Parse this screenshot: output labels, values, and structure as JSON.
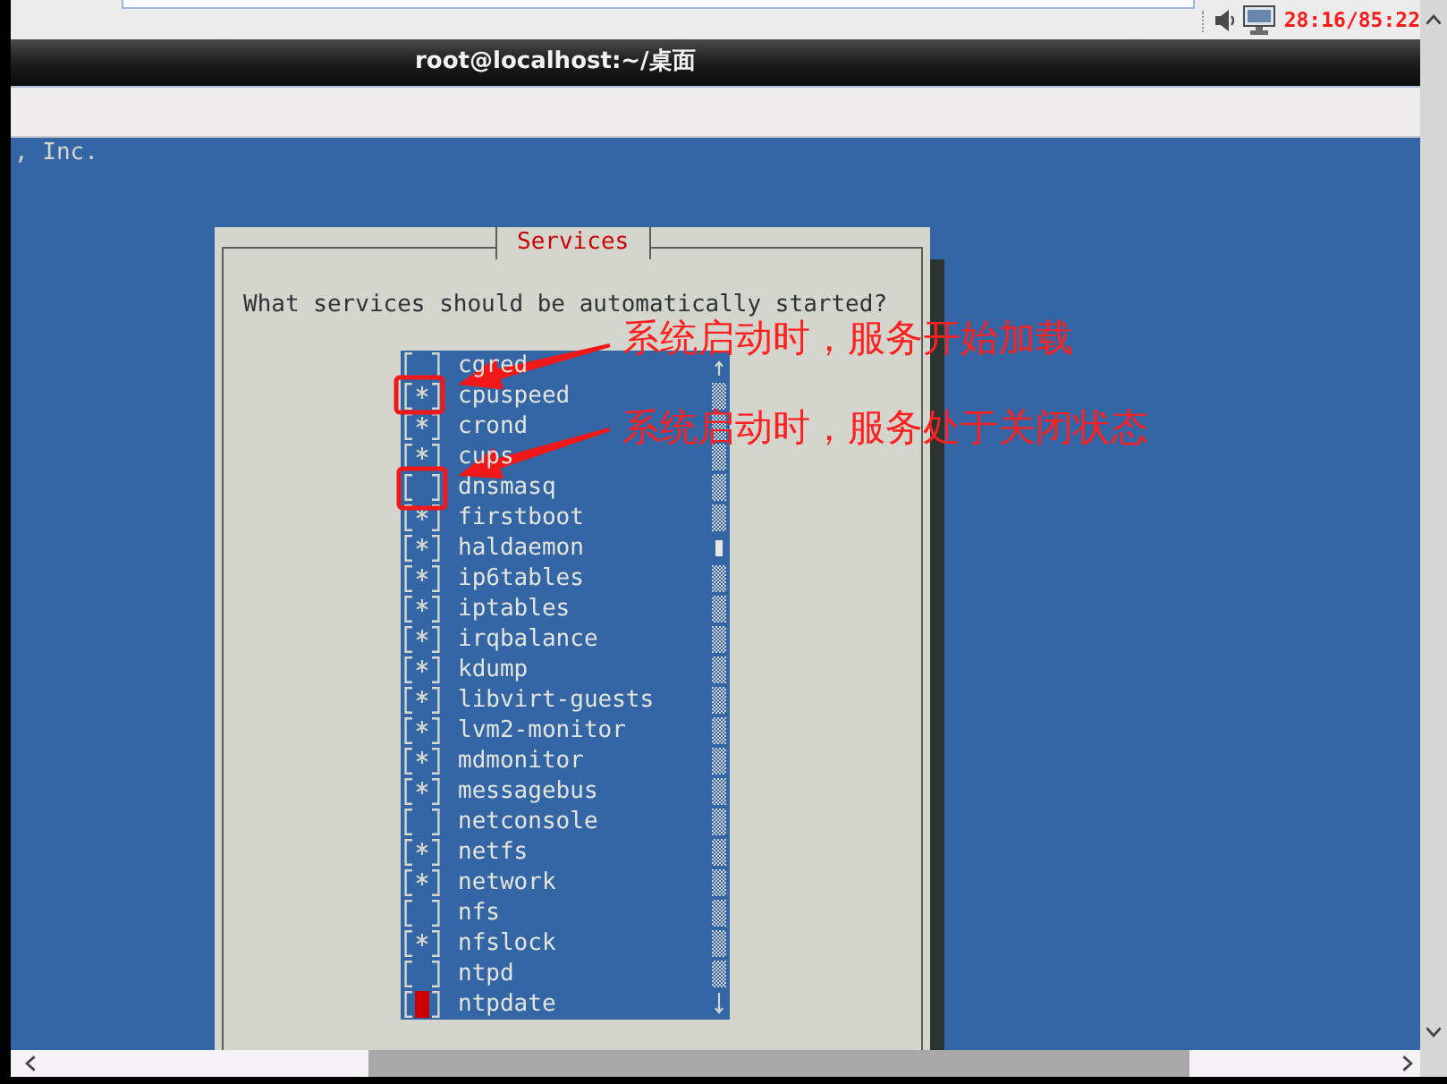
{
  "top_panel": {
    "clock": "28:16/85:22"
  },
  "window": {
    "title": "root@localhost:~/桌面"
  },
  "terminal": {
    "lines": [
      ", Inc."
    ]
  },
  "dialog": {
    "title": "Services",
    "prompt": "What services should be automatically started?",
    "services": [
      {
        "name": "cgred",
        "checked": false,
        "focused": false
      },
      {
        "name": "cpuspeed",
        "checked": true,
        "focused": false
      },
      {
        "name": "crond",
        "checked": true,
        "focused": false
      },
      {
        "name": "cups",
        "checked": true,
        "focused": false
      },
      {
        "name": "dnsmasq",
        "checked": false,
        "focused": false
      },
      {
        "name": "firstboot",
        "checked": true,
        "focused": false
      },
      {
        "name": "haldaemon",
        "checked": true,
        "focused": false
      },
      {
        "name": "ip6tables",
        "checked": true,
        "focused": false
      },
      {
        "name": "iptables",
        "checked": true,
        "focused": false
      },
      {
        "name": "irqbalance",
        "checked": true,
        "focused": false
      },
      {
        "name": "kdump",
        "checked": true,
        "focused": false
      },
      {
        "name": "libvirt-guests",
        "checked": true,
        "focused": false
      },
      {
        "name": "lvm2-monitor",
        "checked": true,
        "focused": false
      },
      {
        "name": "mdmonitor",
        "checked": true,
        "focused": false
      },
      {
        "name": "messagebus",
        "checked": true,
        "focused": false
      },
      {
        "name": "netconsole",
        "checked": false,
        "focused": false
      },
      {
        "name": "netfs",
        "checked": true,
        "focused": false
      },
      {
        "name": "network",
        "checked": true,
        "focused": false
      },
      {
        "name": "nfs",
        "checked": false,
        "focused": false
      },
      {
        "name": "nfslock",
        "checked": true,
        "focused": false
      },
      {
        "name": "ntpd",
        "checked": false,
        "focused": false
      },
      {
        "name": "ntpdate",
        "checked": false,
        "focused": true
      }
    ]
  },
  "annotations": [
    {
      "text": "系统启动时，服务开始加载"
    },
    {
      "text": "系统启动时，服务处于关闭状态"
    }
  ]
}
